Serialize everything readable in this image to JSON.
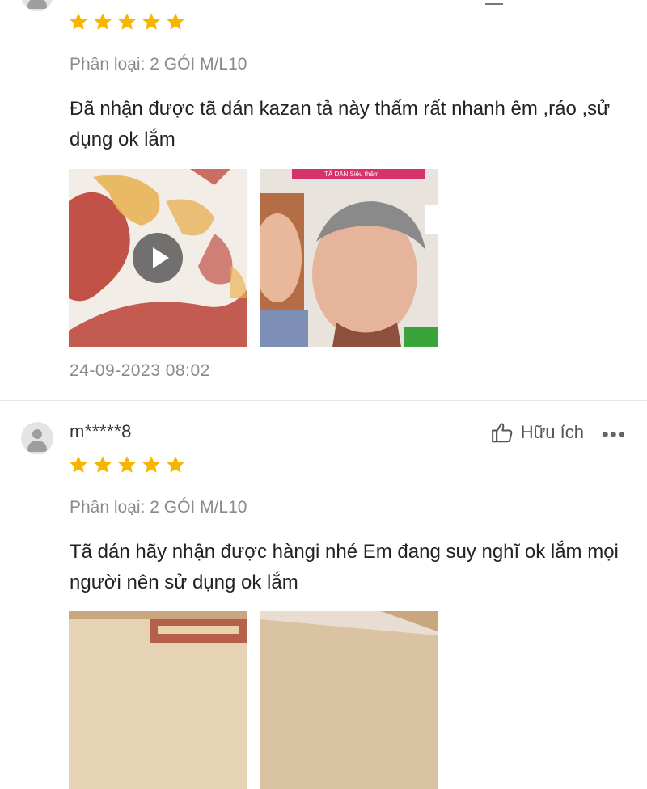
{
  "reviews": [
    {
      "rating": 5,
      "variant": "Phân loại: 2 GÓI M/L10",
      "comment": "Đã nhận được tã dán kazan tả này thấm rất nhanh êm ,ráo ,sử dụng ok lắm",
      "media": [
        {
          "kind": "video",
          "description": "video thumbnail"
        },
        {
          "kind": "photo",
          "banner_text": "TÃ DÁN Siêu thấm"
        }
      ],
      "date": "24-09-2023 08:02"
    },
    {
      "username": "m*****8",
      "helpful_label": "Hữu ích",
      "more_label": "•••",
      "rating": 5,
      "variant": "Phân loại: 2 GÓI M/L10",
      "comment": "Tã dán hãy nhận được hàngi nhé Em đang suy nghĩ ok lắm mọi người nên sử dụng ok lắm",
      "media": [
        {
          "kind": "photo"
        },
        {
          "kind": "photo"
        }
      ]
    }
  ],
  "icons": {
    "avatar": "user-avatar-icon",
    "star": "star-icon",
    "helpful": "thumbs-up-icon",
    "play": "play-icon",
    "more": "more-dots-icon"
  },
  "colors": {
    "star": "#f7b500",
    "muted_text": "#8a8a8a",
    "body_text": "#222222"
  }
}
